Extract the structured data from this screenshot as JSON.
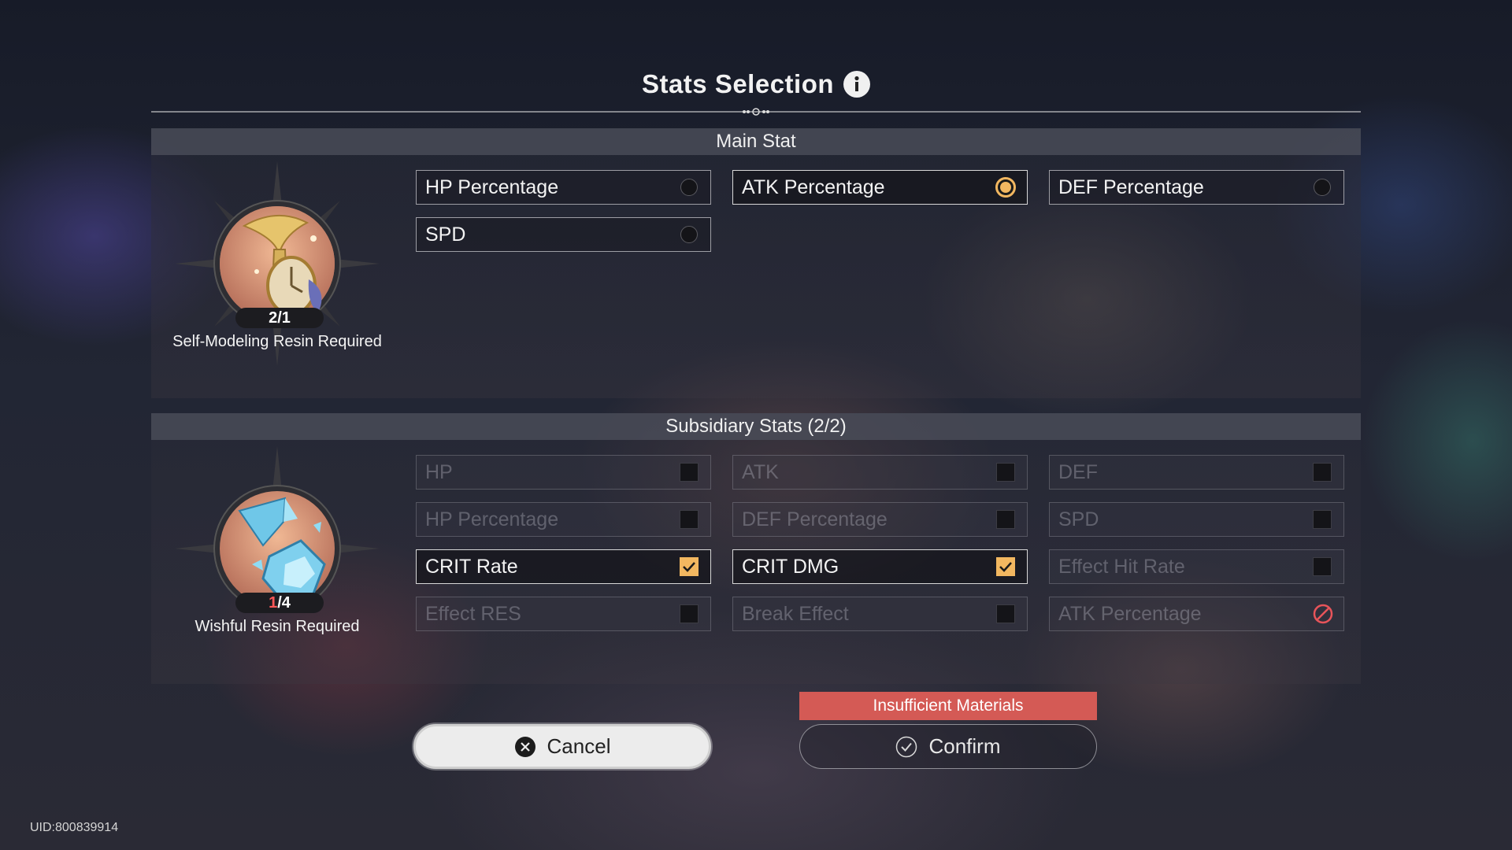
{
  "title": "Stats Selection",
  "colors": {
    "accent": "#f2b760",
    "warning": "#d45a55",
    "disabled_text": "#5f6068"
  },
  "main_stat": {
    "header": "Main Stat",
    "material": {
      "icon": "self-modeling-resin-icon",
      "counter_owned": "2",
      "counter_required": "/1",
      "label": "Self-Modeling Resin Required"
    },
    "options": [
      {
        "label": "HP Percentage",
        "state": "unselected"
      },
      {
        "label": "ATK Percentage",
        "state": "selected"
      },
      {
        "label": "DEF Percentage",
        "state": "unselected"
      },
      {
        "label": "SPD",
        "state": "unselected"
      }
    ]
  },
  "sub_stats": {
    "header": "Subsidiary Stats (2/2)",
    "material": {
      "icon": "wishful-resin-icon",
      "counter_owned": "1",
      "counter_required": "/4",
      "label": "Wishful Resin Required"
    },
    "options": [
      {
        "label": "HP",
        "state": "disabled"
      },
      {
        "label": "ATK",
        "state": "disabled"
      },
      {
        "label": "DEF",
        "state": "disabled"
      },
      {
        "label": "HP Percentage",
        "state": "disabled"
      },
      {
        "label": "DEF Percentage",
        "state": "disabled"
      },
      {
        "label": "SPD",
        "state": "disabled"
      },
      {
        "label": "CRIT Rate",
        "state": "checked"
      },
      {
        "label": "CRIT DMG",
        "state": "checked"
      },
      {
        "label": "Effect Hit Rate",
        "state": "disabled"
      },
      {
        "label": "Effect RES",
        "state": "disabled"
      },
      {
        "label": "Break Effect",
        "state": "disabled"
      },
      {
        "label": "ATK Percentage",
        "state": "banned"
      }
    ]
  },
  "warning": "Insufficient Materials",
  "buttons": {
    "cancel": "Cancel",
    "confirm": "Confirm"
  },
  "uid": "UID:800839914"
}
